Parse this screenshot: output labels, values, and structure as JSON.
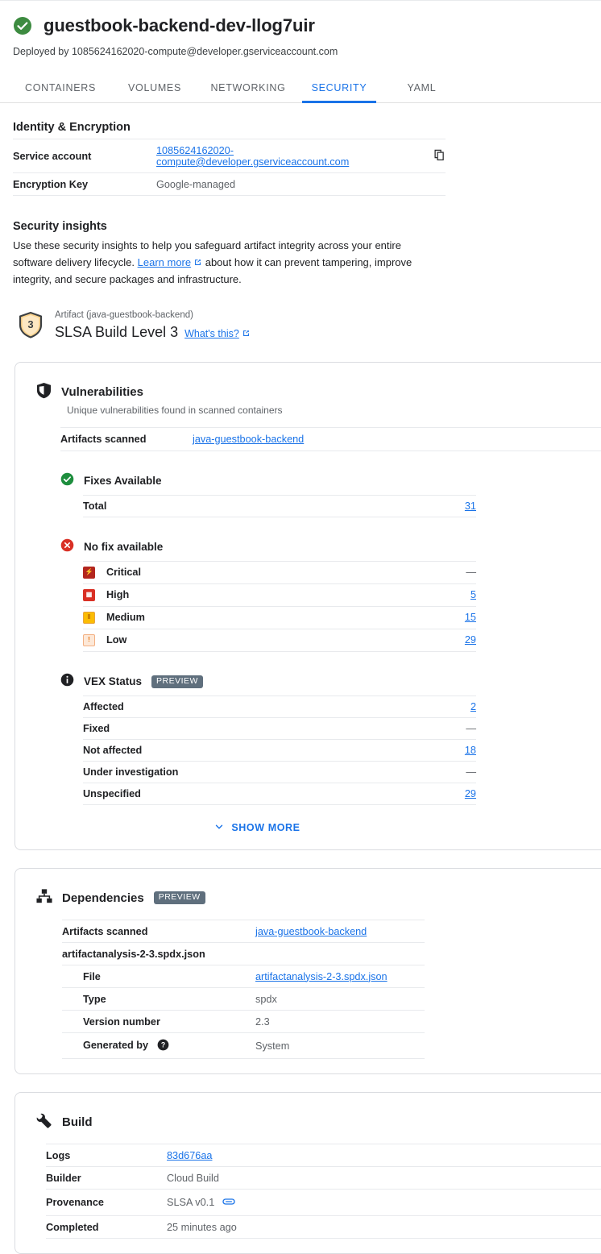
{
  "header": {
    "status_icon": "check-circle-icon",
    "title": "guestbook-backend-dev-llog7uir",
    "deployed_by": "Deployed by 1085624162020-compute@developer.gserviceaccount.com"
  },
  "tabs": [
    {
      "label": "CONTAINERS",
      "active": false
    },
    {
      "label": "VOLUMES",
      "active": false
    },
    {
      "label": "NETWORKING",
      "active": false
    },
    {
      "label": "SECURITY",
      "active": true
    },
    {
      "label": "YAML",
      "active": false
    }
  ],
  "identity": {
    "heading": "Identity & Encryption",
    "rows": [
      {
        "key": "Service account",
        "value": "1085624162020-compute@developer.gserviceaccount.com",
        "link": true,
        "copy_icon": "copy-icon"
      },
      {
        "key": "Encryption Key",
        "value": "Google-managed",
        "link": false
      }
    ]
  },
  "insights": {
    "heading": "Security insights",
    "paragraph_1": "Use these security insights to help you safeguard artifact integrity across your entire software delivery lifecycle. ",
    "learn_more": "Learn more",
    "paragraph_2": " about how it can prevent tampering, improve integrity, and secure packages and infrastructure.",
    "slsa": {
      "badge_level": "3",
      "artifact_label": "Artifact (java-guestbook-backend)",
      "level_text": "SLSA Build Level 3",
      "whats_this": "What's this?"
    }
  },
  "vulnerabilities": {
    "icon": "shield-icon",
    "title": "Vulnerabilities",
    "subtitle": "Unique vulnerabilities found in scanned containers",
    "scanned": {
      "key": "Artifacts scanned",
      "value": "java-guestbook-backend"
    },
    "fixes_available": {
      "icon": "check-circle-icon",
      "title": "Fixes Available",
      "rows": [
        {
          "label": "Total",
          "value": "31",
          "link": true
        }
      ]
    },
    "no_fix": {
      "icon": "error-circle-icon",
      "title": "No fix available",
      "rows": [
        {
          "label": "Critical",
          "severity": "critical",
          "glyph": "⚡",
          "value": "—",
          "link": false
        },
        {
          "label": "High",
          "severity": "high",
          "glyph": "‖",
          "value": "5",
          "link": true
        },
        {
          "label": "Medium",
          "severity": "medium",
          "glyph": "‖",
          "value": "15",
          "link": true
        },
        {
          "label": "Low",
          "severity": "low",
          "glyph": "!",
          "value": "29",
          "link": true
        }
      ]
    },
    "vex": {
      "icon": "info-icon",
      "title": "VEX Status",
      "badge": "PREVIEW",
      "rows": [
        {
          "label": "Affected",
          "value": "2",
          "link": true
        },
        {
          "label": "Fixed",
          "value": "—",
          "link": false
        },
        {
          "label": "Not affected",
          "value": "18",
          "link": true
        },
        {
          "label": "Under investigation",
          "value": "—",
          "link": false
        },
        {
          "label": "Unspecified",
          "value": "29",
          "link": true
        }
      ]
    },
    "show_more": "SHOW MORE"
  },
  "dependencies": {
    "icon": "org-chart-icon",
    "title": "Dependencies",
    "badge": "PREVIEW",
    "rows": [
      {
        "key": "Artifacts scanned",
        "value": "java-guestbook-backend",
        "link": true,
        "indent": false
      },
      {
        "key": "artifactanalysis-2-3.spdx.json",
        "value": "",
        "link": false,
        "indent": false
      },
      {
        "key": "File",
        "value": "artifactanalysis-2-3.spdx.json",
        "link": true,
        "indent": true
      },
      {
        "key": "Type",
        "value": "spdx",
        "link": false,
        "indent": true
      },
      {
        "key": "Version number",
        "value": "2.3",
        "link": false,
        "indent": true
      },
      {
        "key": "Generated by",
        "value": "System",
        "link": false,
        "indent": true,
        "help_icon": "help-icon"
      }
    ]
  },
  "build": {
    "icon": "wrench-icon",
    "title": "Build",
    "rows": [
      {
        "key": "Logs",
        "value": "83d676aa",
        "link": true
      },
      {
        "key": "Builder",
        "value": "Cloud Build",
        "link": false
      },
      {
        "key": "Provenance",
        "value": "SLSA v0.1",
        "link": false,
        "chip_icon": "link-chip-icon"
      },
      {
        "key": "Completed",
        "value": "25 minutes ago",
        "link": false
      }
    ]
  },
  "colors": {
    "accent": "#1a73e8",
    "success": "#34a853",
    "error": "#d93025",
    "badge_bg": "#5f6f7d",
    "text": "#202124",
    "muted": "#5f6368",
    "border": "#e8eaed"
  }
}
